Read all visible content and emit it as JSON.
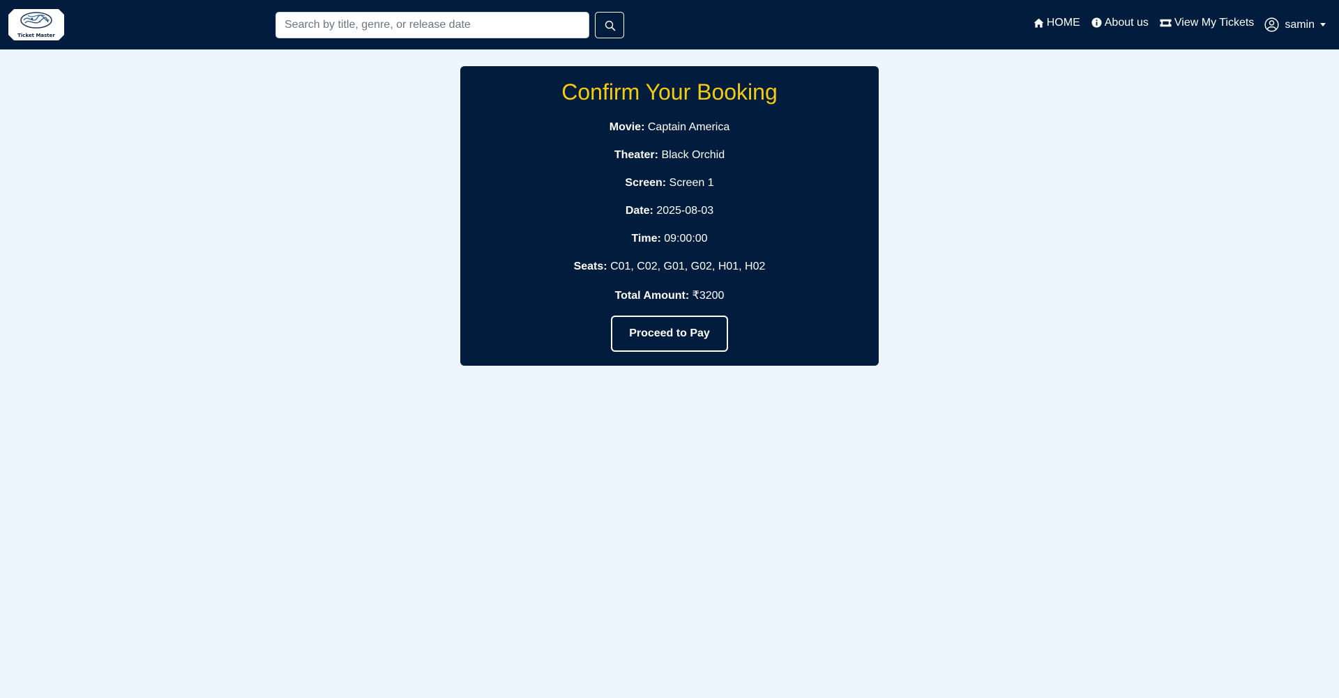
{
  "header": {
    "logo_text": "Ticket Master",
    "search": {
      "placeholder": "Search by title, genre, or release date",
      "value": ""
    },
    "nav": {
      "home": "HOME",
      "about": "About us",
      "tickets": "View My Tickets",
      "user": "samin"
    }
  },
  "booking": {
    "title": "Confirm Your Booking",
    "movie_label": "Movie:",
    "movie": "Captain America",
    "theater_label": "Theater:",
    "theater": "Black Orchid",
    "screen_label": "Screen:",
    "screen": "Screen 1",
    "date_label": "Date:",
    "date": "2025-08-03",
    "time_label": "Time:",
    "time": "09:00:00",
    "seats_label": "Seats:",
    "seats": "C01, C02, G01, G02, H01, H02",
    "total_label": "Total Amount:",
    "total": "₹3200",
    "pay_button": "Proceed to Pay"
  },
  "colors": {
    "navbar": "#011c3c",
    "page_bg": "#eef6fd",
    "card": "#011c3c",
    "title": "#f5cb11"
  },
  "icons": {
    "home": "home-icon",
    "about": "info-icon",
    "tickets": "ticket-icon",
    "user": "user-circle-icon",
    "search": "search-icon"
  }
}
